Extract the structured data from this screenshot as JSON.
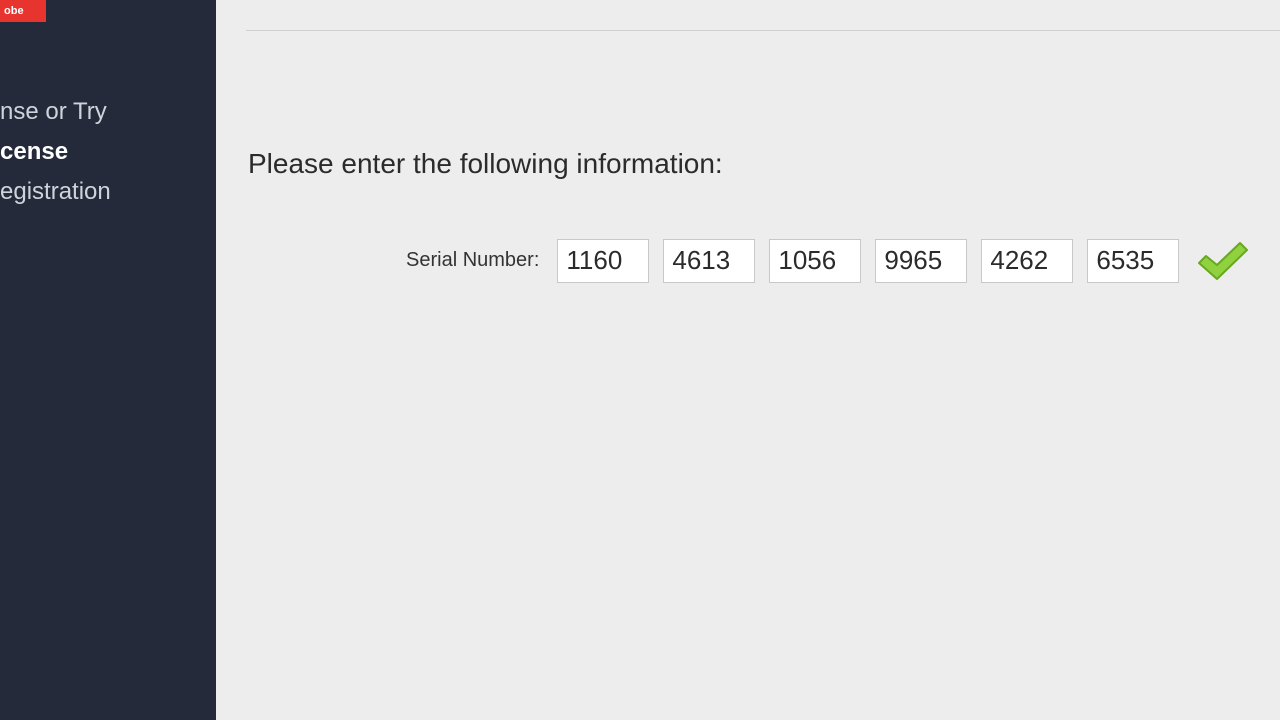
{
  "logo": {
    "text": "obe"
  },
  "sidebar": {
    "items": [
      {
        "label": "nse or Try"
      },
      {
        "label": "cense"
      },
      {
        "label": "egistration"
      }
    ],
    "active_index": 1
  },
  "main": {
    "prompt": "Please enter the following information:",
    "serial_label": "Serial Number:",
    "serial": [
      "1160",
      "4613",
      "1056",
      "9965",
      "4262",
      "6535"
    ],
    "valid": true
  },
  "colors": {
    "sidebar_bg": "#242a3a",
    "logo_bg": "#e8342f",
    "check_fill": "#8fd13f",
    "check_stroke": "#68a81f"
  }
}
